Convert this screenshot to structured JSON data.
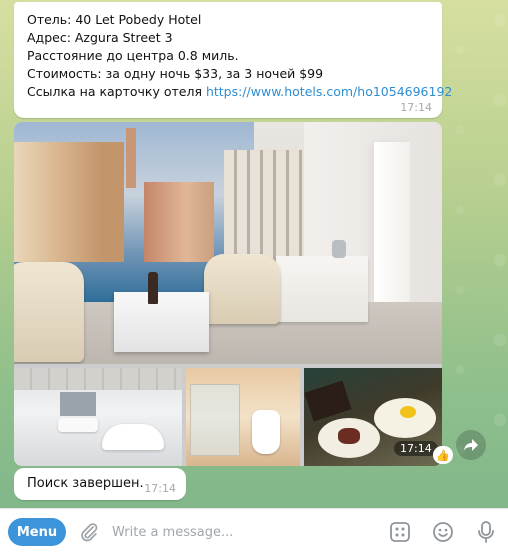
{
  "colors": {
    "accent": "#3d94d9",
    "link": "#2f8ed1",
    "time_gray": "#a3a9ae"
  },
  "hotel_message": {
    "line_hotel": "Отель: 40 Let Pobedy Hotel",
    "line_address": "Адрес: Azgura Street 3",
    "line_distance": "Расстояние до центра 0.8 миль.",
    "line_price": "Стоимость: за одну ночь $33, за 3 ночей $99",
    "link_prefix": "Ссылка на карточку отеля ",
    "link_url": "https://www.hotels.com/ho1054696192",
    "time": "17:14"
  },
  "album": {
    "time": "17:14",
    "reaction": "👍",
    "photos": [
      "room-photo",
      "bathroom-photo",
      "shower-toilet-photo",
      "food-photo"
    ],
    "icons": {
      "share": "share-arrow-icon"
    }
  },
  "done_message": {
    "text": "Поиск завершен.",
    "time": "17:14"
  },
  "input_bar": {
    "menu_label": "Menu",
    "placeholder": "Write a message...",
    "icons": [
      "paperclip-icon",
      "commands-icon",
      "emoji-icon",
      "microphone-icon"
    ]
  }
}
